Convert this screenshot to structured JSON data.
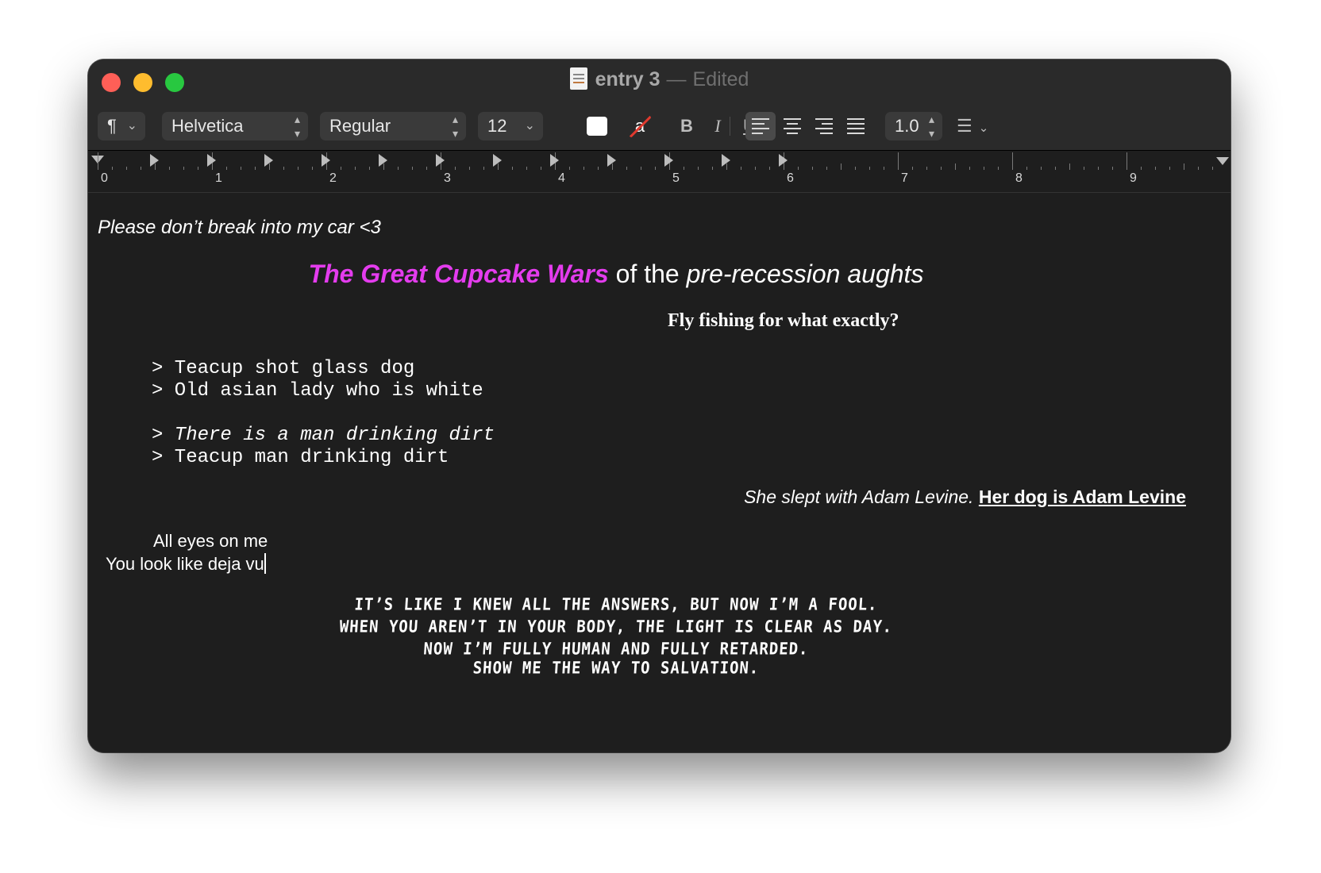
{
  "window": {
    "title": "entry 3",
    "separator": "—",
    "status": "Edited"
  },
  "toolbar": {
    "paragraph_symbol": "¶",
    "font_family": "Helvetica",
    "font_style": "Regular",
    "font_size": "12",
    "text_color": "#ffffff",
    "bold_label": "B",
    "italic_label": "I",
    "underline_label": "U",
    "line_spacing": "1.0",
    "highlight_glyph": "a"
  },
  "ruler": {
    "numbers": [
      "0",
      "1",
      "2",
      "3",
      "4",
      "5",
      "6",
      "7",
      "8",
      "9"
    ]
  },
  "document": {
    "line1": "Please don’t break into my car <3",
    "heading_colored": "The Great Cupcake Wars",
    "heading_mid": " of the ",
    "heading_italic": "pre-recession aughts",
    "heading_color": "#e43cee",
    "line3": "Fly fishing for what exactly?",
    "quote1": "> Teacup shot glass dog",
    "quote2": "> Old asian lady who is white",
    "quote3": "> There is a man drinking dirt",
    "quote4": "> Teacup man drinking dirt",
    "adam_plain": "She slept with Adam Levine. ",
    "adam_link": "Her dog is Adam Levine",
    "eyes1": "All eyes on me",
    "eyes2": "You look like deja vu",
    "stylized1": "IT’S LIKE I KNEW ALL THE ANSWERS, BUT NOW I’M A FOOL.",
    "stylized2": "WHEN YOU AREN’T IN YOUR BODY, THE LIGHT IS CLEAR AS DAY.",
    "stylized3": "NOW I’M FULLY HUMAN AND FULLY RETARDED.",
    "stylized4": "SHOW ME THE WAY TO SALVATION."
  }
}
